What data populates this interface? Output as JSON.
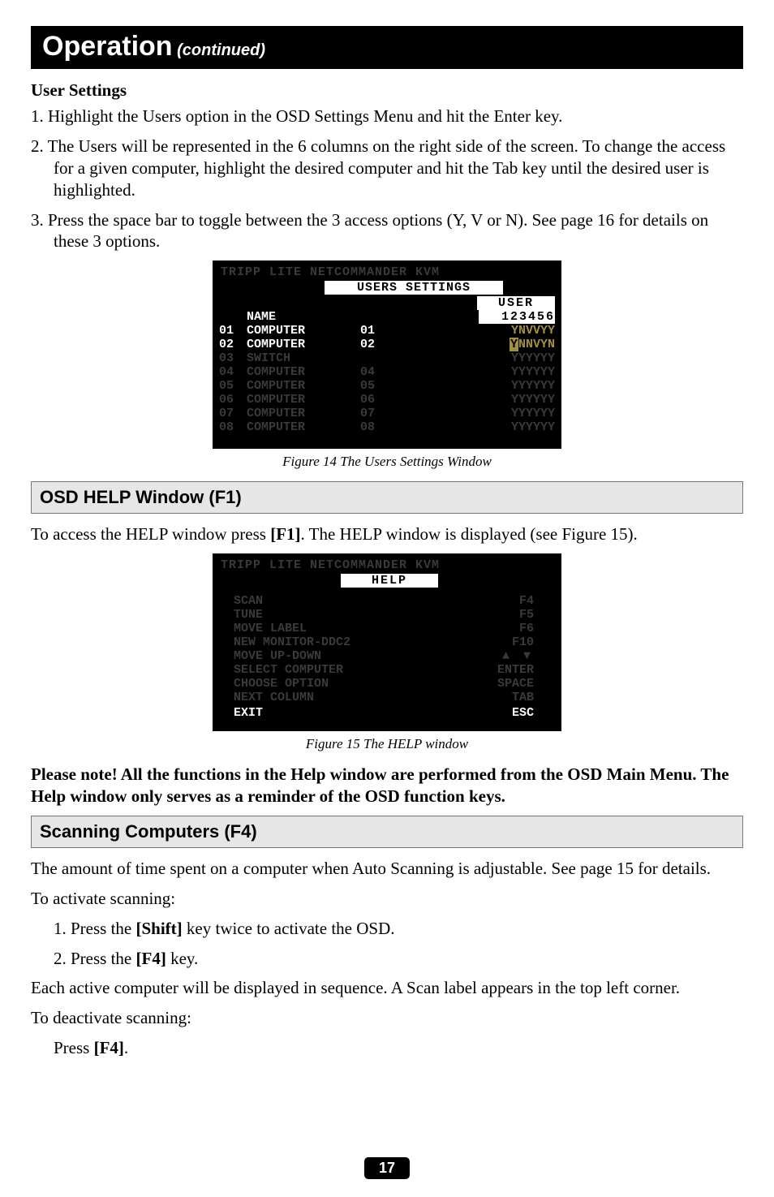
{
  "header": {
    "main": "Operation",
    "sub": " (continued)"
  },
  "user_settings": {
    "title": "User Settings",
    "steps": [
      "1. Highlight the Users option in the OSD Settings Menu and hit the Enter key.",
      "2. The Users will be represented in the 6 columns on the right side of the screen. To change the access for a given computer, highlight the desired computer and hit the Tab key until the desired user is highlighted.",
      "3. Press the space bar to toggle between the 3 access options (Y, V or N). See page 16 for details on these 3 options."
    ]
  },
  "osd1": {
    "brand": "TRIPP LITE NETCOMMANDER KVM",
    "subtitle": "USERS SETTINGS",
    "user_hdr": "USER",
    "name_hdr": "NAME",
    "num_hdr": "123456",
    "rows": [
      {
        "n": "01",
        "name": "COMPUTER",
        "n2": "01",
        "user": "YNVVYY",
        "active": true
      },
      {
        "n": "02",
        "name": "COMPUTER",
        "n2": "02",
        "user": "NNVYN",
        "active": true,
        "ycursor": true
      },
      {
        "n": "03",
        "name": "SWITCH",
        "n2": "",
        "user": "YYYYYY",
        "active": false
      },
      {
        "n": "04",
        "name": "COMPUTER",
        "n2": "04",
        "user": "YYYYYY",
        "active": false
      },
      {
        "n": "05",
        "name": "COMPUTER",
        "n2": "05",
        "user": "YYYYYY",
        "active": false
      },
      {
        "n": "06",
        "name": "COMPUTER",
        "n2": "06",
        "user": "YYYYYY",
        "active": false
      },
      {
        "n": "07",
        "name": "COMPUTER",
        "n2": "07",
        "user": "YYYYYY",
        "active": false
      },
      {
        "n": "08",
        "name": "COMPUTER",
        "n2": "08",
        "user": "YYYYYY",
        "active": false
      }
    ],
    "caption": "Figure 14 The Users Settings Window"
  },
  "help_section": {
    "title": "OSD HELP Window (F1)",
    "intro_pre": "To access the HELP window press ",
    "intro_key": "[F1]",
    "intro_post": ". The HELP window is displayed (see Figure 15)."
  },
  "osd2": {
    "brand": "TRIPP LITE NETCOMMANDER KVM",
    "subtitle": "HELP",
    "rows": [
      {
        "l": "SCAN",
        "r": "F4"
      },
      {
        "l": "TUNE",
        "r": "F5"
      },
      {
        "l": "MOVE LABEL",
        "r": "F6"
      },
      {
        "l": "NEW MONITOR-DDC2",
        "r": "F10"
      },
      {
        "l": "MOVE UP-DOWN",
        "r": "▲ ▼",
        "arrows": true
      },
      {
        "l": "SELECT COMPUTER",
        "r": "ENTER"
      },
      {
        "l": "CHOOSE OPTION",
        "r": "SPACE"
      },
      {
        "l": "NEXT COLUMN",
        "r": "TAB"
      }
    ],
    "exit_l": "EXIT",
    "exit_r": "ESC",
    "caption": "Figure 15 The HELP window"
  },
  "note": "Please note! All the functions in the Help window are performed from the OSD Main Menu. The Help window only serves as a reminder of the OSD function keys.",
  "scan_section": {
    "title": "Scanning Computers (F4)",
    "p1": "The amount of time spent on a computer when Auto Scanning is adjustable. See page 15 for details.",
    "p2": "To activate scanning:",
    "s1_pre": "1. Press the ",
    "s1_key": "[Shift]",
    "s1_post": " key twice to activate the OSD.",
    "s2_pre": "2. Press the ",
    "s2_key": "[F4]",
    "s2_post": " key.",
    "p3": "Each active computer will be displayed in sequence. A Scan label appears in the top left corner.",
    "p4": "To deactivate scanning:",
    "s3_pre": "Press ",
    "s3_key": "[F4]",
    "s3_post": "."
  },
  "page": "17"
}
